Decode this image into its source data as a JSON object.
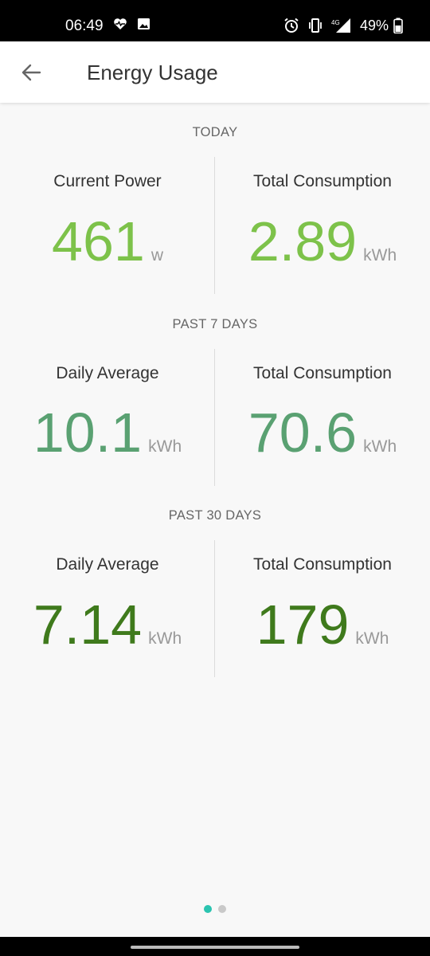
{
  "status_bar": {
    "time": "06:49",
    "battery": "49%",
    "icons": [
      "heart-pulse-icon",
      "image-icon",
      "alarm-icon",
      "vibrate-icon",
      "signal-4g-icon",
      "battery-icon"
    ]
  },
  "app_bar": {
    "title": "Energy Usage",
    "back_icon": "arrow-left-icon"
  },
  "sections": [
    {
      "header": "TODAY",
      "left": {
        "label": "Current Power",
        "value": "461",
        "unit": "w"
      },
      "right": {
        "label": "Total Consumption",
        "value": "2.89",
        "unit": "kWh"
      },
      "color": "#7dc24a"
    },
    {
      "header": "PAST 7 DAYS",
      "left": {
        "label": "Daily Average",
        "value": "10.1",
        "unit": "kWh"
      },
      "right": {
        "label": "Total Consumption",
        "value": "70.6",
        "unit": "kWh"
      },
      "color": "#5aa172"
    },
    {
      "header": "PAST 30 DAYS",
      "left": {
        "label": "Daily Average",
        "value": "7.14",
        "unit": "kWh"
      },
      "right": {
        "label": "Total Consumption",
        "value": "179",
        "unit": "kWh"
      },
      "color": "#3f7a1c"
    }
  ],
  "page_indicator": {
    "pages": 2,
    "active_index": 0,
    "active_color": "#2bc4b0",
    "inactive_color": "#c9c9c9"
  }
}
